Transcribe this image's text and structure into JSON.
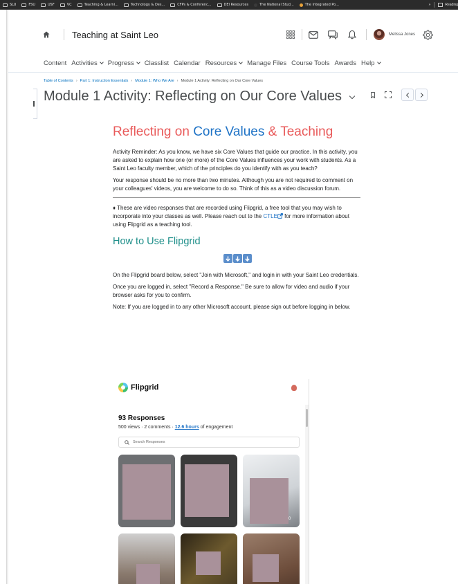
{
  "bookmarks": [
    {
      "label": "SLU",
      "type": "folder"
    },
    {
      "label": "FSU",
      "type": "folder"
    },
    {
      "label": "USF",
      "type": "folder"
    },
    {
      "label": "VC",
      "type": "folder"
    },
    {
      "label": "Teaching & Learni...",
      "type": "folder"
    },
    {
      "label": "Technology & Des...",
      "type": "folder"
    },
    {
      "label": "CFPs & Conferenc...",
      "type": "folder"
    },
    {
      "label": "DEI Resources",
      "type": "folder"
    },
    {
      "label": "The National Stud...",
      "type": "site"
    },
    {
      "label": "The Integrated Po...",
      "type": "site"
    }
  ],
  "bookmarks_right": {
    "more": "»",
    "reading_list": "Reading"
  },
  "navbar": {
    "org_title": "Teaching at Saint Leo",
    "username": "Melissa Jones",
    "icons": [
      "grid-icon",
      "mail-icon",
      "chat-icon",
      "bell-icon",
      "gear-icon"
    ]
  },
  "menu": [
    {
      "label": "Content",
      "dropdown": false
    },
    {
      "label": "Activities",
      "dropdown": true
    },
    {
      "label": "Progress",
      "dropdown": true
    },
    {
      "label": "Classlist",
      "dropdown": false
    },
    {
      "label": "Calendar",
      "dropdown": false
    },
    {
      "label": "Resources",
      "dropdown": true
    },
    {
      "label": "Manage Files",
      "dropdown": false
    },
    {
      "label": "Course Tools",
      "dropdown": false
    },
    {
      "label": "Awards",
      "dropdown": false
    },
    {
      "label": "Help",
      "dropdown": true
    }
  ],
  "breadcrumb": [
    {
      "label": "Table of Contents",
      "link": true
    },
    {
      "label": "Part 1: Instruction Essentials",
      "link": true
    },
    {
      "label": "Module 1: Who We Are",
      "link": true
    },
    {
      "label": "Module 1 Activity: Reflecting on Our Core Values",
      "link": false
    }
  ],
  "page_title": "Module 1 Activity: Reflecting on Our Core Values",
  "content": {
    "heading": {
      "part1": "Reflecting on ",
      "part2": "Core Values",
      "part3": " & ",
      "part4": "Teaching"
    },
    "para1": "Activity Reminder: As you know, we have six Core Values that guide our practice. In this activity, you are asked to explain how one (or more) of the Core Values influences your work with students. As a Saint Leo faculty member, which of the principles do you identify with as you teach?",
    "para2": "Your response should be no more than two minutes. Although you are not required to comment on your colleagues' videos, you are welcome to do so. Think of this as a video discussion forum.",
    "para3_before": "♦ These are video responses that are recorded using Flipgrid, a free tool that you may wish to incorporate into your classes as well.  Please reach out to the ",
    "para3_link": "CTLE",
    "para3_after": " for more information about using Flipgrid as a teaching tool.",
    "subheading": "How to Use Flipgrid",
    "para4": "On the Flipgrid board below, select \"Join with Microsoft,\" and login in with your Saint Leo credentials.",
    "para5": "Once you are logged in, select \"Record a Response.\" Be sure to allow for video and audio if your browser asks for you to confirm.",
    "para6": "Note: If you are logged in to any other Microsoft account, please sign out before logging in below."
  },
  "flipgrid": {
    "brand": "Flipgrid",
    "responses": "93 Responses",
    "stats_before": "500 views · 2 comments · ",
    "stats_highlight": "12.6 hours",
    "stats_after": " of engagement",
    "search_placeholder": "Search Responses",
    "thumb_label": "0"
  }
}
